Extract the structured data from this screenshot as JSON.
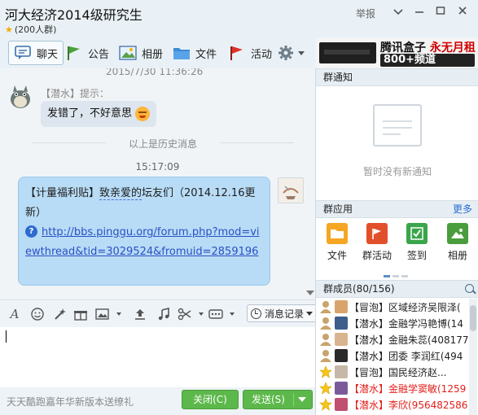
{
  "window": {
    "title": "河大经济2014级研究生",
    "members_count": "(200人群)",
    "report_label": "举报",
    "controls": [
      "minimize",
      "maximize",
      "close"
    ]
  },
  "toolbar": {
    "items": [
      {
        "label": "聊天",
        "icon": "chat-bubble-icon"
      },
      {
        "label": "公告",
        "icon": "flag-icon"
      },
      {
        "label": "相册",
        "icon": "photo-icon"
      },
      {
        "label": "文件",
        "icon": "folder-icon"
      },
      {
        "label": "活动",
        "icon": "red-flag-icon"
      }
    ],
    "settings_icon": "gear-icon"
  },
  "ad": {
    "line1_black": "腾讯盒子",
    "line1_red": "永无月租",
    "line2": "800+频道"
  },
  "chat": {
    "timestamp_top": "2015/7/30 11:36:26",
    "sender": "【潜水】提示：",
    "message1": "发错了，不好意思",
    "history_divider": "以上是历史消息",
    "timestamp_mid": "15:17:09",
    "message2_prefix": "【计量福利贴】",
    "message2_underlined": "致亲爱的",
    "message2_rest": "坛友们（2014.12.16更新）",
    "link": "http://bbs.pinggu.org/forum.php?mod=viewthread&tid=3029524&fromuid=2859196"
  },
  "input_toolbar": {
    "icons": [
      "font-icon",
      "emoji-icon",
      "magic-icon",
      "gift-icon",
      "screenshot-icon",
      "music-icon",
      "upload-icon",
      "music-note-icon",
      "scissors-icon",
      "more-icon"
    ],
    "history_label": "消息记录"
  },
  "bottom": {
    "promo": "天天酷跑嘉年华新版本送缭礼",
    "close_label": "关闭(C)",
    "send_label": "发送(S)"
  },
  "right_panel": {
    "notice_header": "群通知",
    "notice_empty": "暂时没有新通知",
    "apps_header": "群应用",
    "apps_more": "更多",
    "apps": [
      {
        "label": "文件",
        "color": "#f5a623"
      },
      {
        "label": "群活动",
        "color": "#e2502b"
      },
      {
        "label": "签到",
        "color": "#3aa54a"
      },
      {
        "label": "相册",
        "color": "#4a9d3d"
      }
    ],
    "members_header": "群成员(80/156)",
    "members": [
      {
        "text": "【冒泡】区域经济吴限泽(",
        "red": false,
        "role_color": "#c8a46a",
        "av_color": "#d9a46b"
      },
      {
        "text": "【潜水】金融学冯艳博(14",
        "red": false,
        "role_color": "#c8a46a",
        "av_color": "#3e5f8a"
      },
      {
        "text": "【潜水】金融朱蕊(408177",
        "red": false,
        "role_color": "#c8a46a",
        "av_color": "#d8b58f"
      },
      {
        "text": "【潜水】团委 李润红(494",
        "red": false,
        "role_color": "#c8a46a",
        "av_color": "#2a2a2a"
      },
      {
        "text": "【冒泡】国民经济赵...",
        "red": false,
        "role_color": "#f5c518",
        "av_color": "#c6b8a8"
      },
      {
        "text": "【潜水】金融学窦敏(1259",
        "red": true,
        "role_color": "#f5c518",
        "av_color": "#7a5b9a"
      },
      {
        "text": "【潜水】李欣(956482586)",
        "red": true,
        "role_color": "#f5c518",
        "av_color": "#c05070"
      }
    ]
  }
}
